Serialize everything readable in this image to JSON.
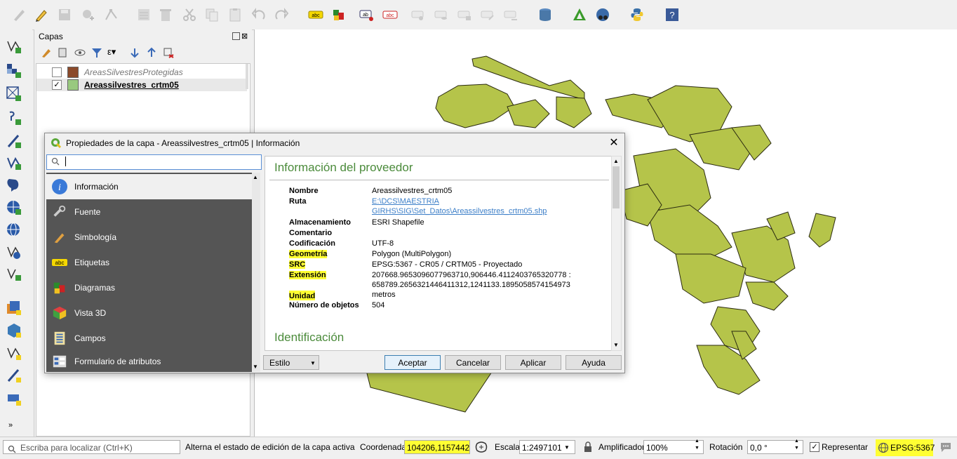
{
  "toolbar": {
    "icons": [
      "digitize-icon",
      "pencil-edit-icon",
      "save-edits-icon",
      "add-point-icon",
      "vertex-tool-icon",
      "modify-attributes-icon",
      "delete-selected-icon",
      "cut-icon",
      "copy-icon",
      "paste-icon",
      "undo-icon",
      "redo-icon",
      "label-abc-icon",
      "diagram-icon",
      "label-pin-icon",
      "label-highlight-icon",
      "label-tool-1-icon",
      "label-tool-2-icon",
      "label-tool-3-icon",
      "label-tool-4-icon",
      "label-tool-5-icon",
      "database-icon",
      "grass-icon",
      "georeferencer-icon",
      "python-icon",
      "help-icon"
    ]
  },
  "layers_panel": {
    "title": "Capas",
    "layers": [
      {
        "name": "AreasSilvestresProtegidas",
        "checked": false,
        "color": "#8b4a2b",
        "style": "italic"
      },
      {
        "name": "Areassilvestres_crtm05",
        "checked": true,
        "check_mark": "✓",
        "color": "#99c97f",
        "style": "bold-underline"
      }
    ]
  },
  "dialog": {
    "title": "Propiedades de la capa - Areassilvestres_crtm05 | Información",
    "close": "✕",
    "search_value": "",
    "nav": [
      {
        "label": "Información",
        "icon": "info-icon",
        "selected": true
      },
      {
        "label": "Fuente",
        "icon": "source-icon"
      },
      {
        "label": "Simbología",
        "icon": "symbology-icon"
      },
      {
        "label": "Etiquetas",
        "icon": "labels-icon"
      },
      {
        "label": "Diagramas",
        "icon": "diagrams-icon"
      },
      {
        "label": "Vista 3D",
        "icon": "3d-view-icon"
      },
      {
        "label": "Campos",
        "icon": "fields-icon"
      },
      {
        "label": "Formulario de atributos",
        "icon": "attribute-form-icon"
      }
    ],
    "section1": "Información del proveedor",
    "section2": "Identificación",
    "fields": {
      "nombre": {
        "key": "Nombre",
        "value": "Areassilvestres_crtm05"
      },
      "ruta": {
        "key": "Ruta",
        "value1": "E:\\DCS\\MAESTRIA",
        "value2": "GIRHS\\SIG\\Set_Datos\\Areassilvestres_crtm05.shp"
      },
      "almacenamiento": {
        "key": "Almacenamiento",
        "value": "ESRI Shapefile"
      },
      "comentario": {
        "key": "Comentario",
        "value": ""
      },
      "codificacion": {
        "key": "Codificación",
        "value": "UTF-8"
      },
      "geometria": {
        "key": "Geometría",
        "value": "Polygon (MultiPolygon)"
      },
      "src": {
        "key": "SRC",
        "value": "EPSG:5367 - CR05 / CRTM05 - Proyectado"
      },
      "extension": {
        "key": "Extensión",
        "value1": "207668.9653096077963710,906446.4112403765320778 :",
        "value2": "658789.2656321446411312,1241133.1895058574154973"
      },
      "unidad": {
        "key": "Unidad",
        "value": "metros"
      },
      "numero": {
        "key": "Número de objetos",
        "value": "504"
      }
    },
    "buttons": {
      "estilo": "Estilo",
      "aceptar": "Aceptar",
      "cancelar": "Cancelar",
      "aplicar": "Aplicar",
      "ayuda": "Ayuda"
    }
  },
  "statusbar": {
    "locate_placeholder": "Escriba para localizar (Ctrl+K)",
    "message": "Alterna el estado de edición de la capa activa",
    "coord_label": "Coordenada",
    "coord_value": "104206,1157442",
    "scale_label": "Escala",
    "scale_value": "1:2497101",
    "magnifier_label": "Amplificador",
    "magnifier_value": "100%",
    "rotation_label": "Rotación",
    "rotation_value": "0,0 °",
    "render_label": "Representar",
    "render_check": "✓",
    "crs": "EPSG:5367"
  },
  "colors": {
    "accent_green": "#4b8b3b",
    "polygon_fill": "#b5c44a",
    "highlight": "#ffff33"
  }
}
